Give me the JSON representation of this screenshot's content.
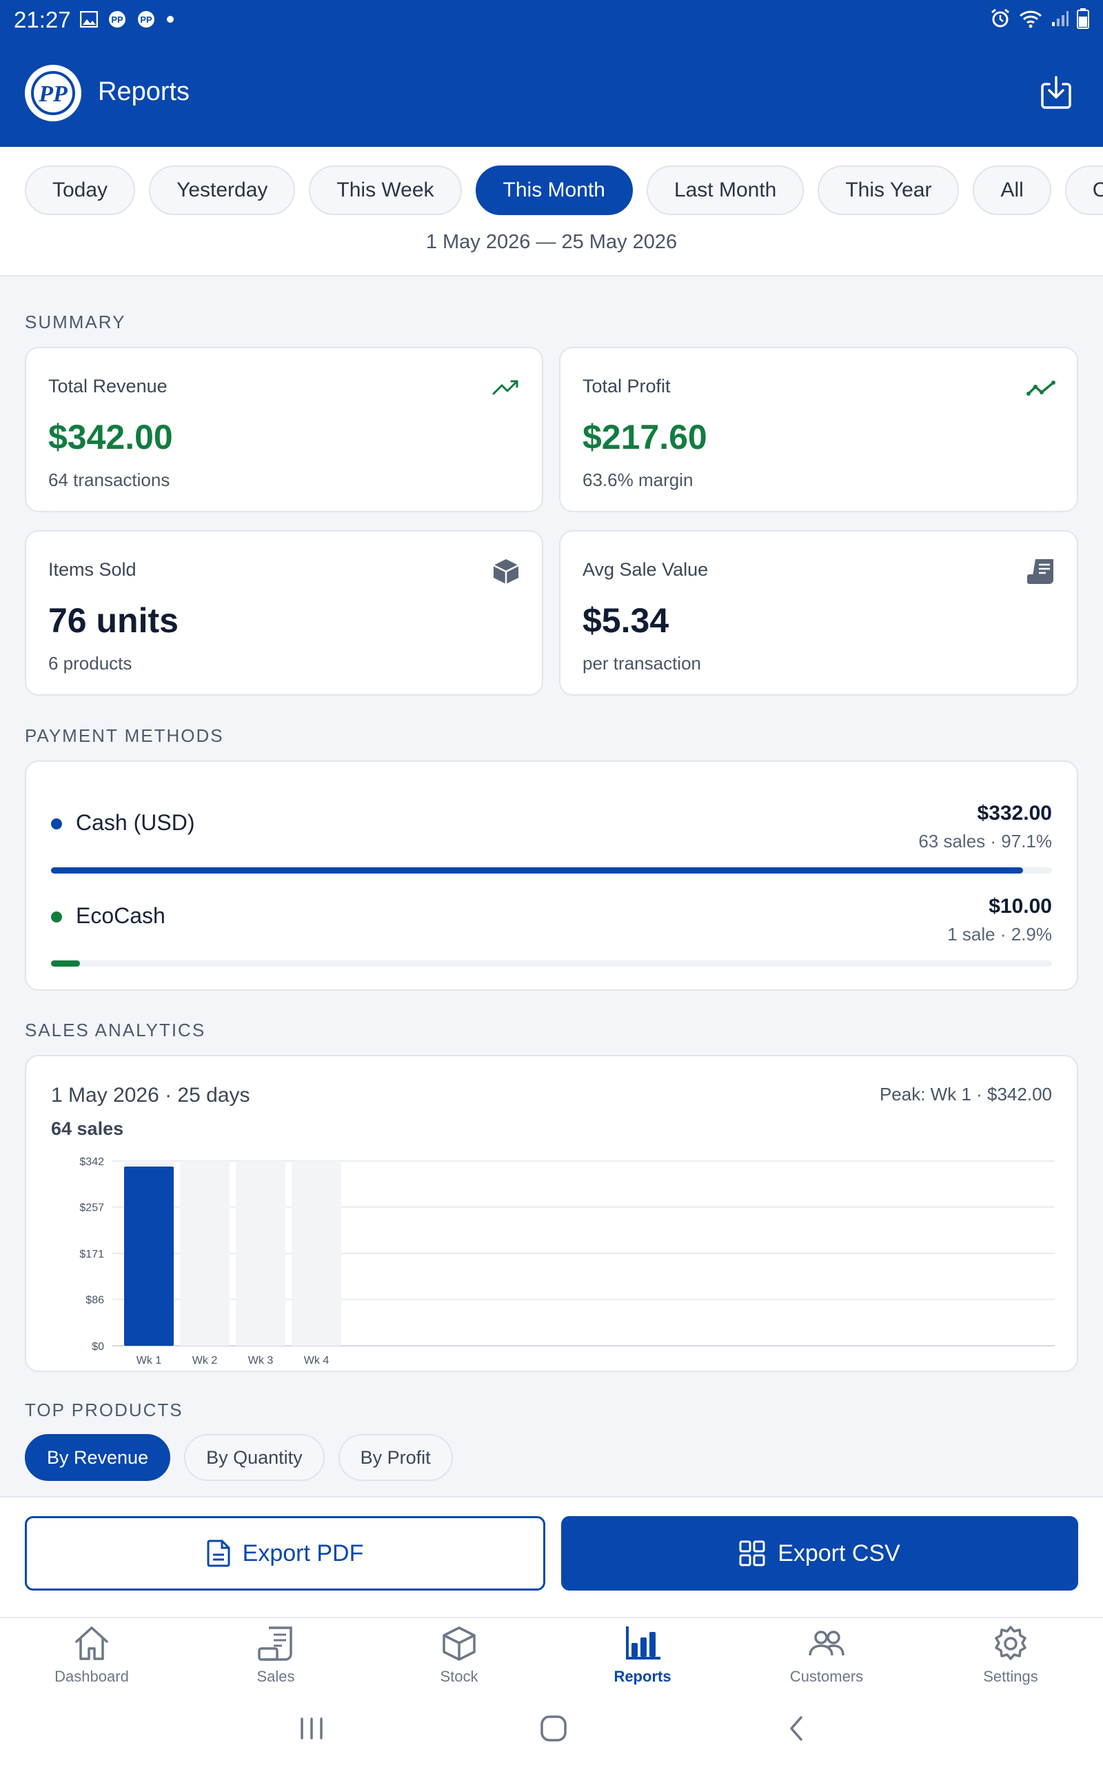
{
  "status_bar": {
    "time": "21:27",
    "left_icons": [
      "image-icon",
      "app-notification-icon",
      "app-notification-icon",
      "dot-icon"
    ],
    "right_icons": [
      "alarm-icon",
      "wifi-icon",
      "signal-icon",
      "battery-icon"
    ]
  },
  "app_bar": {
    "logo_text": "PP",
    "title": "Reports",
    "action_icon": "download-icon"
  },
  "period_tabs": {
    "items": [
      "Today",
      "Yesterday",
      "This Week",
      "This Month",
      "Last Month",
      "This Year",
      "All",
      "Custom"
    ],
    "active": "This Month",
    "range": "1 May 2026 — 25 May 2026"
  },
  "summary": {
    "label": "SUMMARY",
    "cards": [
      {
        "label": "Total Revenue",
        "value": "$342.00",
        "sub": "64 transactions",
        "icon": "trending-up-icon"
      },
      {
        "label": "Total Profit",
        "value": "$217.60",
        "sub": "63.6% margin",
        "icon": "trend-line-icon"
      },
      {
        "label": "Items Sold",
        "value": "76 units",
        "sub": "6 products",
        "icon": "cube-icon"
      },
      {
        "label": "Avg Sale Value",
        "value": "$5.34",
        "sub": "per transaction",
        "icon": "receipt-icon"
      }
    ]
  },
  "payment_methods": {
    "label": "PAYMENT METHODS",
    "items": [
      {
        "name": "Cash (USD)",
        "amount": "$332.00",
        "meta": "63 sales · 97.1%",
        "share": 0.971,
        "color": "#0847ad"
      },
      {
        "name": "EcoCash",
        "amount": "$10.00",
        "meta": "1 sale · 2.9%",
        "share": 0.029,
        "color": "#127c3f"
      }
    ]
  },
  "sales_analytics": {
    "label": "SALES ANALYTICS",
    "period": "1 May 2026 · 25 days",
    "sales": "64 sales",
    "peak": "Peak: Wk 1 · $342.00"
  },
  "chart_data": {
    "type": "bar",
    "categories": [
      "Wk 1",
      "Wk 2",
      "Wk 3",
      "Wk 4"
    ],
    "values": [
      342,
      0,
      0,
      0
    ],
    "ylim": [
      0,
      342
    ],
    "yticks": [
      0,
      86,
      171,
      257,
      342
    ],
    "ytick_labels": [
      "$0",
      "$86",
      "$171",
      "$257",
      "$342"
    ],
    "title": "",
    "xlabel": "",
    "ylabel": "",
    "grid": true,
    "bar_color": "#0847ad",
    "empty_bar_color": "#f3f4f8"
  },
  "top_products": {
    "label": "TOP PRODUCTS",
    "tabs": [
      "By Revenue",
      "By Quantity",
      "By Profit"
    ],
    "active": "By Revenue"
  },
  "export": {
    "pdf_label": "Export PDF",
    "csv_label": "Export CSV"
  },
  "bottom_nav": {
    "items": [
      {
        "label": "Dashboard",
        "icon": "home-icon"
      },
      {
        "label": "Sales",
        "icon": "receipt-icon"
      },
      {
        "label": "Stock",
        "icon": "cube-icon"
      },
      {
        "label": "Reports",
        "icon": "bar-chart-icon"
      },
      {
        "label": "Customers",
        "icon": "users-icon"
      },
      {
        "label": "Settings",
        "icon": "gear-icon"
      }
    ],
    "active": "Reports"
  },
  "colors": {
    "primary": "#0847ad",
    "success": "#127c3f",
    "background": "#f3f5f9"
  }
}
